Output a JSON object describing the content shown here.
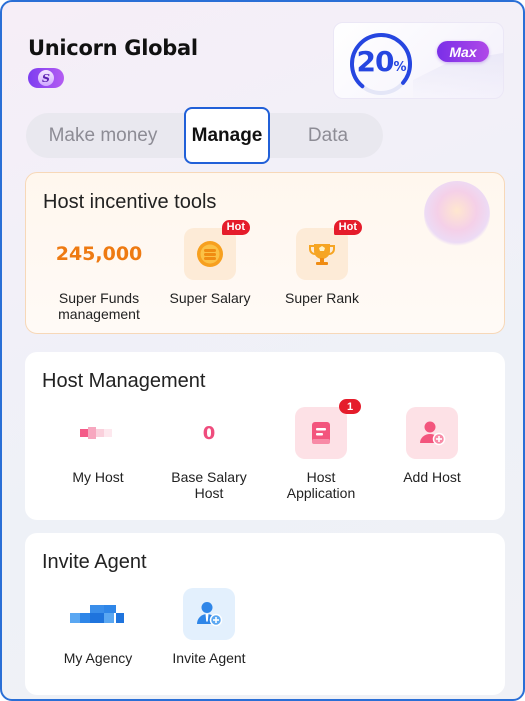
{
  "header": {
    "org_name": "Unicorn Global",
    "badge_letter": "S",
    "level_percent": "20",
    "level_percent_unit": "%",
    "level_ring_fraction": 0.75,
    "max_label": "Max"
  },
  "tabs": [
    {
      "label": "Make money",
      "active": false
    },
    {
      "label": "Manage",
      "active": true
    },
    {
      "label": "Data",
      "active": false
    }
  ],
  "incentive": {
    "title": "Host incentive tools",
    "items": [
      {
        "label": "Super Funds\nmanagement",
        "value": "245,000",
        "icon": "value-display"
      },
      {
        "label": "Super Salary",
        "badge": "Hot",
        "icon": "coin-stack-icon"
      },
      {
        "label": "Super Rank",
        "badge": "Hot",
        "icon": "trophy-icon"
      }
    ]
  },
  "management": {
    "title": "Host Management",
    "items": [
      {
        "label": "My Host",
        "icon": "blurred-avatar-icon"
      },
      {
        "label": "Base Salary\nHost",
        "value": "0"
      },
      {
        "label": "Host\nApplication",
        "badge": "1",
        "icon": "application-form-icon"
      },
      {
        "label": "Add Host",
        "icon": "add-person-icon"
      }
    ]
  },
  "invite": {
    "title": "Invite Agent",
    "items": [
      {
        "label": "My Agency",
        "icon": "agency-blocks-icon"
      },
      {
        "label": "Invite Agent",
        "icon": "agent-add-icon"
      }
    ]
  },
  "colors": {
    "accent_blue": "#2646e0",
    "hot_red": "#e51c2b",
    "orange_value": "#ee7a12",
    "pink_value": "#ef4c7d",
    "max_purple": "#7a2fe8"
  }
}
